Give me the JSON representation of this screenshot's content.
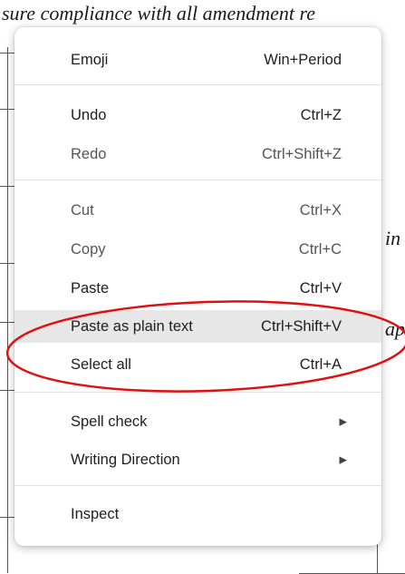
{
  "document": {
    "top_line": "sure compliance with all amendment re",
    "right_fragment_1": "in",
    "right_fragment_2": "ap"
  },
  "menu": {
    "items": [
      {
        "label": "Emoji",
        "shortcut": "Win+Period",
        "disabled": false
      },
      {
        "label": "Undo",
        "shortcut": "Ctrl+Z",
        "disabled": false
      },
      {
        "label": "Redo",
        "shortcut": "Ctrl+Shift+Z",
        "disabled": true
      },
      {
        "label": "Cut",
        "shortcut": "Ctrl+X",
        "disabled": true
      },
      {
        "label": "Copy",
        "shortcut": "Ctrl+C",
        "disabled": true
      },
      {
        "label": "Paste",
        "shortcut": "Ctrl+V",
        "disabled": false
      },
      {
        "label": "Paste as plain text",
        "shortcut": "Ctrl+Shift+V",
        "disabled": false,
        "highlighted": true
      },
      {
        "label": "Select all",
        "shortcut": "Ctrl+A",
        "disabled": false
      },
      {
        "label": "Spell check",
        "submenu": true
      },
      {
        "label": "Writing Direction",
        "submenu": true
      },
      {
        "label": "Inspect"
      }
    ]
  },
  "icons": {
    "submenu_arrow": "▶"
  },
  "colors": {
    "annotation_ellipse": "#e01010",
    "highlight": "#e7e7e7"
  }
}
